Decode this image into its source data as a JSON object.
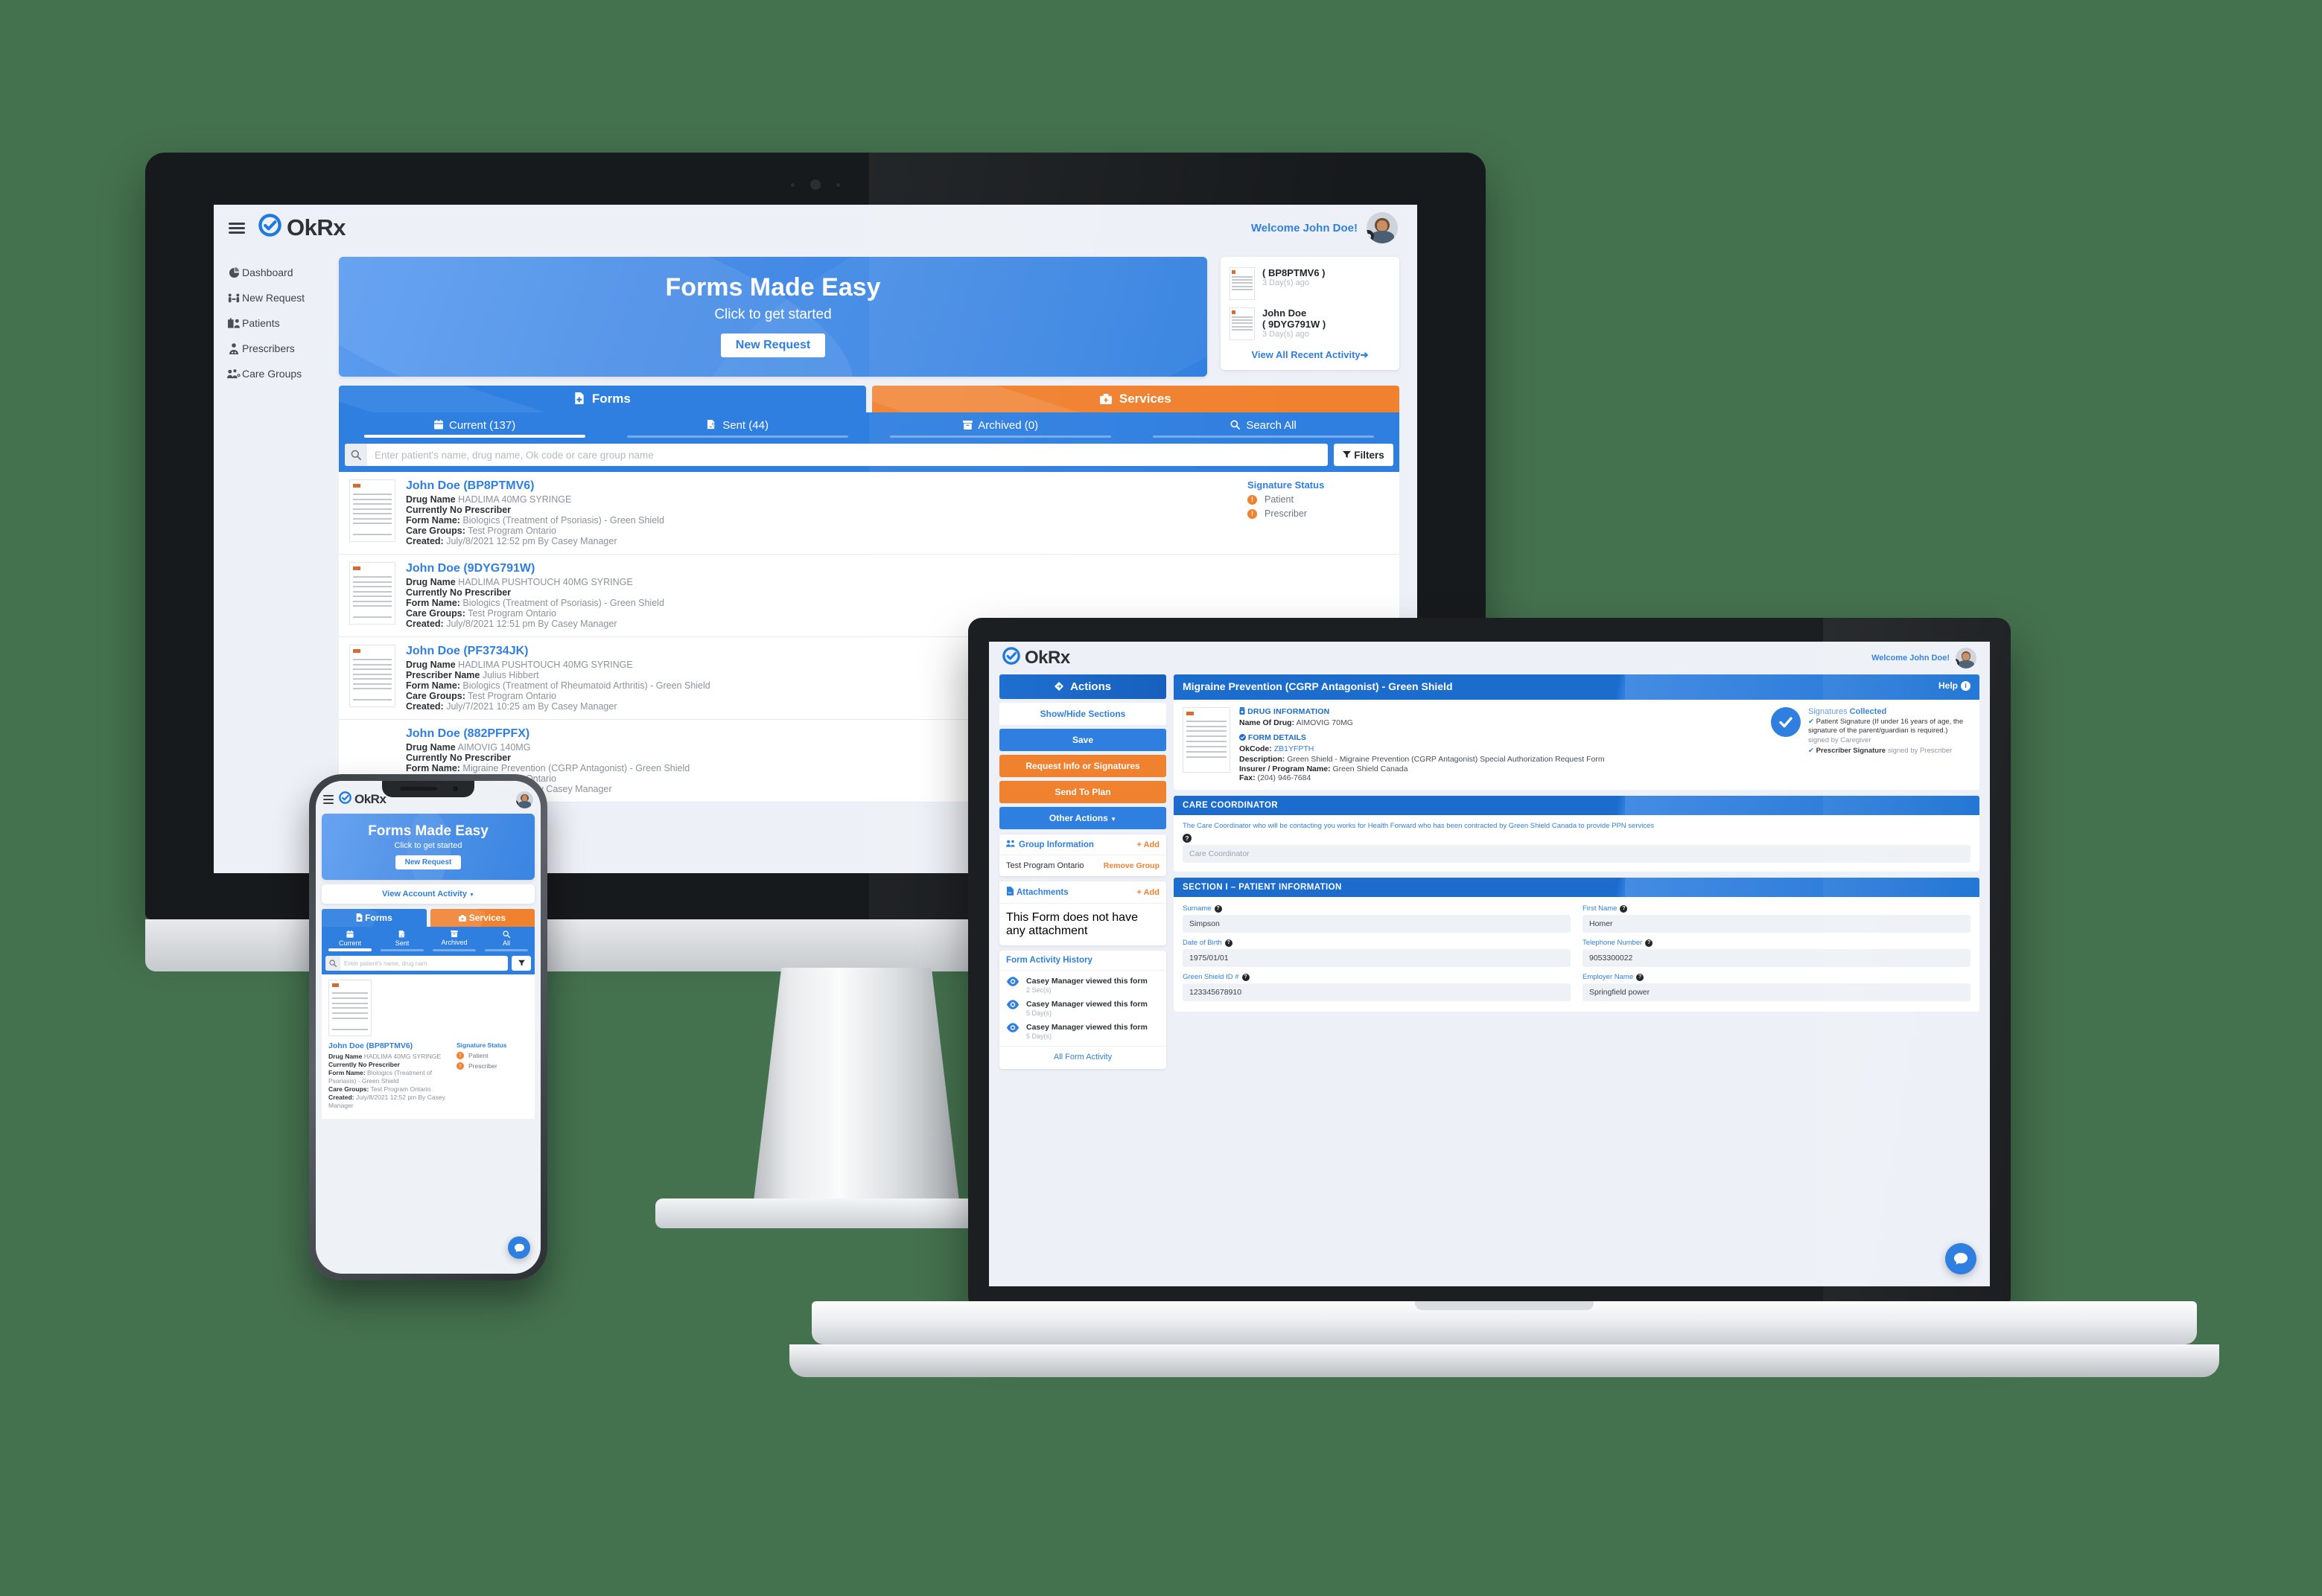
{
  "brand": {
    "name": "OkRx",
    "logo_icon": "check-circle-icon"
  },
  "desktop": {
    "header": {
      "welcome": "Welcome John Doe!",
      "menu_icon": "hamburger-icon",
      "avatar_icon": "user-avatar",
      "gear_icon": "gear-icon"
    },
    "sidebar": {
      "items": [
        {
          "label": "Dashboard",
          "icon": "pie-chart-icon"
        },
        {
          "label": "New Request",
          "icon": "handshake-icon"
        },
        {
          "label": "Patients",
          "icon": "hospital-users-icon"
        },
        {
          "label": "Prescribers",
          "icon": "doctor-icon"
        },
        {
          "label": "Care Groups",
          "icon": "user-group-icon"
        }
      ]
    },
    "hero": {
      "title": "Forms Made Easy",
      "subtitle": "Click to get started",
      "button": "New Request"
    },
    "recent_activity": {
      "items": [
        {
          "name": "",
          "code": "( BP8PTMV6 )",
          "time": "3 Day(s) ago"
        },
        {
          "name": "John Doe",
          "code": "( 9DYG791W )",
          "time": "3 Day(s) ago"
        }
      ],
      "view_all": "View All Recent Activity"
    },
    "main_tabs": [
      {
        "label": "Forms",
        "icon": "file-medical-icon",
        "active": true
      },
      {
        "label": "Services",
        "icon": "briefcase-medical-icon",
        "active": false
      }
    ],
    "sub_tabs": [
      {
        "label": "Current (137)",
        "icon": "calendar-icon",
        "active": true
      },
      {
        "label": "Sent (44)",
        "icon": "file-signature-icon",
        "active": false
      },
      {
        "label": "Archived (0)",
        "icon": "archive-icon",
        "active": false
      },
      {
        "label": "Search All",
        "icon": "search-icon",
        "active": false
      }
    ],
    "search": {
      "placeholder": "Enter patient's name, drug name, Ok code or care group name",
      "value": "",
      "icon": "search-icon"
    },
    "filters_button": {
      "label": "Filters",
      "icon": "funnel-icon"
    },
    "signature_status": {
      "title": "Signature Status",
      "rows": [
        {
          "label": "Patient",
          "state": "pending"
        },
        {
          "label": "Prescriber",
          "state": "pending"
        }
      ]
    },
    "labels": {
      "drug_name": "Drug Name",
      "prescriber_name": "Prescriber Name",
      "no_prescriber": "Currently No Prescriber",
      "form_name": "Form Name:",
      "care_groups": "Care Groups:",
      "created": "Created:"
    },
    "rows": [
      {
        "title": "John Doe (BP8PTMV6)",
        "drug": "HADLIMA 40MG SYRINGE",
        "prescriber": "Currently No Prescriber",
        "form": "Biologics (Treatment of Psoriasis) - Green Shield",
        "groups": "Test Program Ontario",
        "created": "July/8/2021 12:52 pm By Casey Manager"
      },
      {
        "title": "John Doe (9DYG791W)",
        "drug": "HADLIMA PUSHTOUCH 40MG SYRINGE",
        "prescriber": "Currently No Prescriber",
        "form": "Biologics (Treatment of Psoriasis) - Green Shield",
        "groups": "Test Program Ontario",
        "created": "July/8/2021 12:51 pm By Casey Manager"
      },
      {
        "title": "John Doe (PF3734JK)",
        "drug": "HADLIMA PUSHTOUCH 40MG SYRINGE",
        "prescriber_name": "Julius Hibbert",
        "form": "Biologics (Treatment of Rheumatoid Arthritis) - Green Shield",
        "groups": "Test Program Ontario",
        "created": "July/7/2021 10:25 am By Casey Manager"
      },
      {
        "title": "John Doe (882PFPFX)",
        "drug": "AIMOVIG 140MG",
        "prescriber": "Currently No Prescriber",
        "form": "Migraine Prevention (CGRP Antagonist) - Green Shield",
        "groups": "Test Program Ontario",
        "created": "July/6/2021 1:57 pm By Casey Manager"
      }
    ]
  },
  "phone": {
    "hero": {
      "title": "Forms Made Easy",
      "subtitle": "Click to get started",
      "button": "New Request"
    },
    "account_activity": "View Account Activity",
    "main_tabs": [
      {
        "label": "Forms",
        "icon": "file-medical-icon",
        "active": true
      },
      {
        "label": "Services",
        "icon": "briefcase-medical-icon",
        "active": false
      }
    ],
    "sub_tabs": [
      {
        "label": "Current",
        "icon": "calendar-icon",
        "active": true
      },
      {
        "label": "Sent",
        "icon": "file-signature-icon",
        "active": false
      },
      {
        "label": "Archived",
        "icon": "archive-icon",
        "active": false
      },
      {
        "label": "All",
        "icon": "search-icon",
        "active": false
      }
    ],
    "search": {
      "placeholder": "Enter patient's name, drug nam",
      "value": ""
    },
    "filters_icon": "funnel-icon",
    "row": {
      "title": "John Doe (BP8PTMV6)",
      "drug_label": "Drug Name",
      "drug": "HADLIMA 40MG SYRINGE",
      "prescriber": "Currently No Prescriber",
      "form_label": "Form Name:",
      "form": "Biologics (Treatment of Psoriasis) - Green Shield",
      "groups_label": "Care Groups:",
      "groups": "Test Program Ontario",
      "created_label": "Created:",
      "created": "July/8/2021 12:52 pm By Casey Manager"
    },
    "signature_status": {
      "title": "Signature Status",
      "rows": [
        {
          "label": "Patient"
        },
        {
          "label": "Prescriber"
        }
      ]
    },
    "chat_icon": "chat-bubble-icon"
  },
  "laptop": {
    "header": {
      "welcome": "Welcome John Doe!",
      "avatar_icon": "user-avatar",
      "gear_icon": "gear-icon"
    },
    "actions": {
      "header": "Actions",
      "header_icon": "diamond-arrows-icon",
      "buttons": [
        {
          "label": "Show/Hide Sections",
          "style": "white"
        },
        {
          "label": "Save",
          "style": "blue"
        },
        {
          "label": "Request Info or Signatures",
          "style": "orange"
        },
        {
          "label": "Send To Plan",
          "style": "orange"
        },
        {
          "label": "Other Actions",
          "style": "blue",
          "caret": true
        }
      ]
    },
    "group_information": {
      "title": "Group Information",
      "icon": "users-icon",
      "add_label": "Add",
      "group_name": "Test Program Ontario",
      "remove_label": "Remove Group"
    },
    "attachments": {
      "title": "Attachments",
      "icon": "file-attachment-icon",
      "add_label": "Add",
      "empty_text": "This Form does not have any attachment"
    },
    "activity_history": {
      "title": "Form Activity History",
      "items": [
        {
          "text": "Casey Manager viewed this form",
          "time": "2 Sec(s)",
          "icon": "eye-icon"
        },
        {
          "text": "Casey Manager viewed this form",
          "time": "5 Day(s)",
          "icon": "eye-icon"
        },
        {
          "text": "Casey Manager viewed this form",
          "time": "5 Day(s)",
          "icon": "eye-icon"
        }
      ],
      "all_link": "All Form Activity"
    },
    "form": {
      "title": "Migraine Prevention (CGRP Antagonist) - Green Shield",
      "help_label": "Help",
      "help_icon": "info-icon",
      "drug_information": {
        "heading": "DRUG INFORMATION",
        "icon": "pill-bottle-icon",
        "name_label": "Name Of Drug:",
        "name_value": "AIMOVIG 70MG"
      },
      "form_details": {
        "heading": "FORM DETAILS",
        "icon": "shield-check-icon",
        "okcode_label": "OkCode:",
        "okcode_value": "ZB1YFPTH",
        "description_label": "Description:",
        "description_value": "Green Shield - Migraine Prevention (CGRP Antagonist) Special Authorization Request Form",
        "insurer_label": "Insurer / Program Name:",
        "insurer_value": "Green Shield Canada",
        "fax_label": "Fax:",
        "fax_value": "(204) 946-7684"
      },
      "signatures": {
        "title_prefix": "Signatures",
        "title_strong": "Collected",
        "check_icon": "check-circle-icon",
        "items": [
          {
            "text": "Patient Signature (If under 16 years of age, the signature of the parent/guardian is required.)",
            "by": "signed by Caregiver"
          },
          {
            "text": "Prescriber Signature",
            "by": "signed by Prescriber"
          }
        ]
      },
      "care_coordinator": {
        "heading": "CARE COORDINATOR",
        "note": "The Care Coordinator who will be contacting you works for Health Forward who has been contracted by Green Shield Canada to provide PPN services",
        "help_icon": "question-icon",
        "placeholder": "Care Coordinator",
        "value": ""
      },
      "patient_section": {
        "heading": "SECTION I – PATIENT INFORMATION",
        "fields": [
          {
            "label": "Surname",
            "value": "Simpson"
          },
          {
            "label": "First Name",
            "value": "Homer"
          },
          {
            "label": "Date of Birth",
            "value": "1975/01/01"
          },
          {
            "label": "Telephone Number",
            "value": "9053300022"
          },
          {
            "label": "Green Shield ID #",
            "value": "123345678910"
          },
          {
            "label": "Employer Name",
            "value": "Springfield power"
          }
        ]
      }
    },
    "chat_icon": "chat-bubble-icon"
  },
  "colors": {
    "background": "#44714E",
    "primary_blue": "#2f7fe0",
    "dark_blue": "#1b6ccd",
    "orange": "#f0812f",
    "app_bg": "#edf1f7",
    "muted": "#8b929b"
  }
}
